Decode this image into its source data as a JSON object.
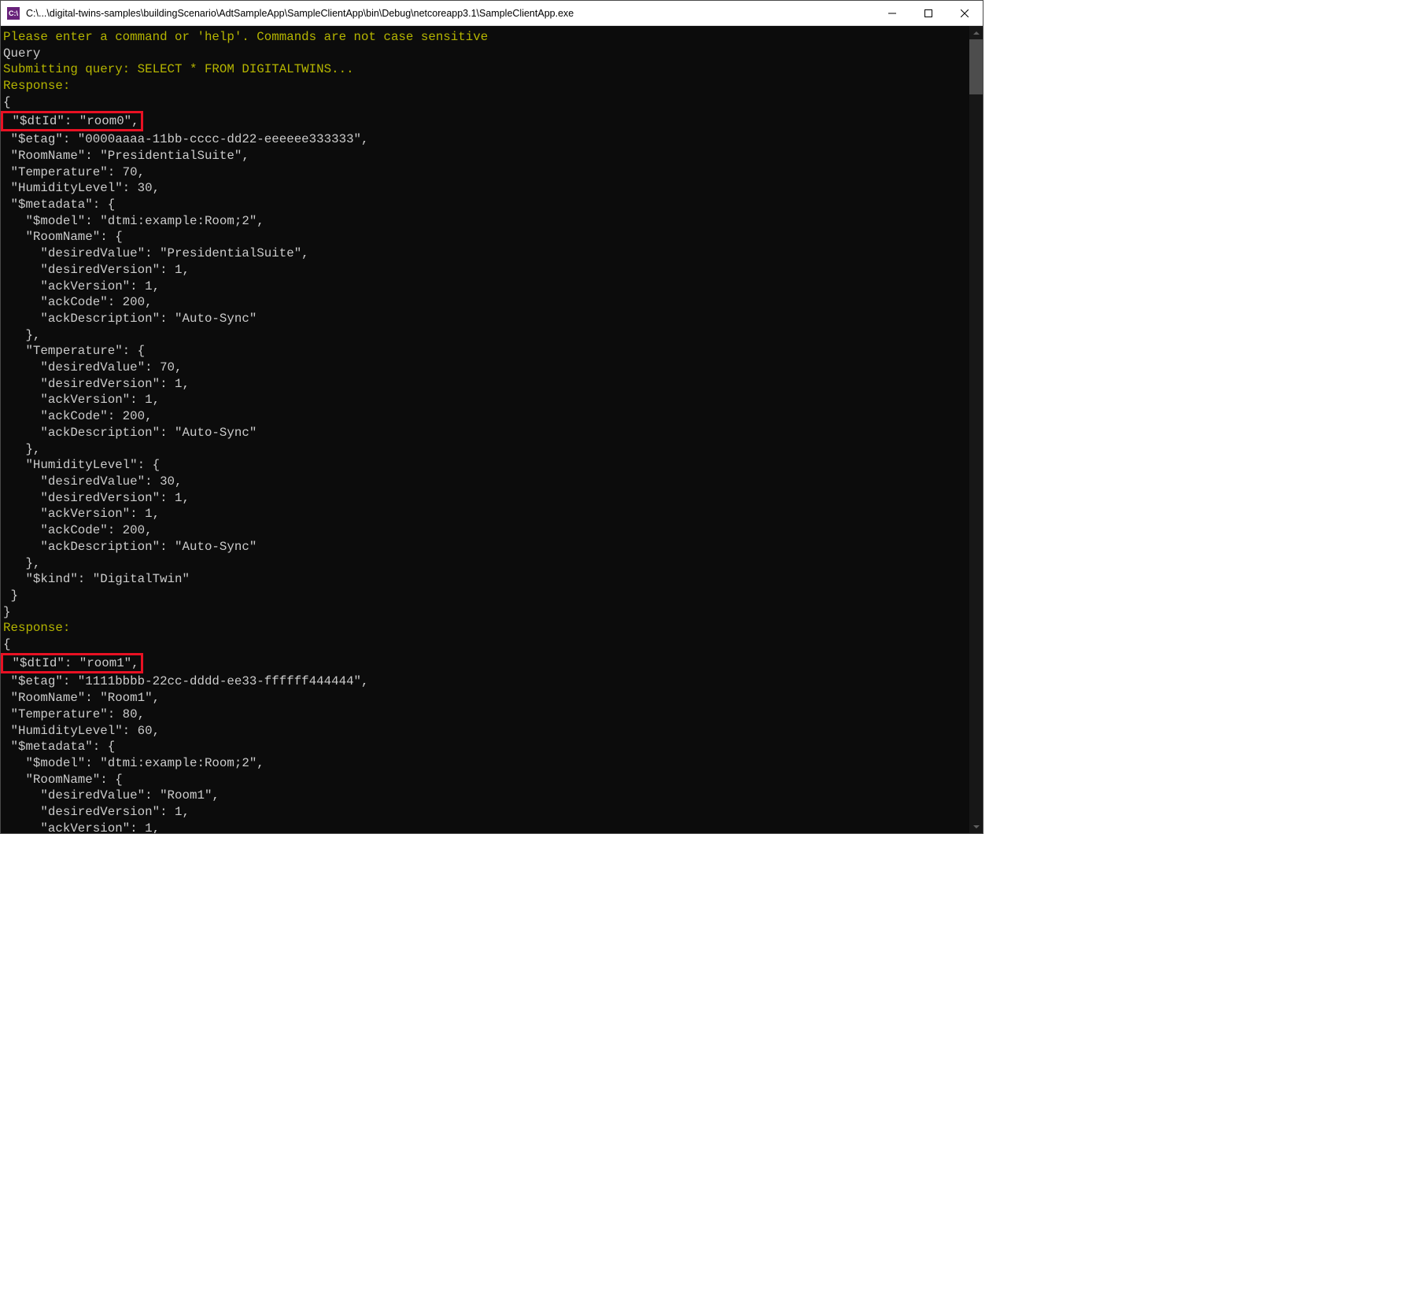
{
  "titlebar": {
    "icon_text": "C:\\",
    "path": "C:\\...\\digital-twins-samples\\buildingScenario\\AdtSampleApp\\SampleClientApp\\bin\\Debug\\netcoreapp3.1\\SampleClientApp.exe"
  },
  "console": {
    "prompt_line": "Please enter a command or 'help'. Commands are not case sensitive",
    "query_cmd": "Query",
    "submit_line": "Submitting query: SELECT * FROM DIGITALTWINS...",
    "response_label": "Response:",
    "body1_open": "{",
    "body1_dtid": " \"$dtId\": \"room0\",",
    "body1_rest": " \"$etag\": \"0000aaaa-11bb-cccc-dd22-eeeeee333333\",\n \"RoomName\": \"PresidentialSuite\",\n \"Temperature\": 70,\n \"HumidityLevel\": 30,\n \"$metadata\": {\n   \"$model\": \"dtmi:example:Room;2\",\n   \"RoomName\": {\n     \"desiredValue\": \"PresidentialSuite\",\n     \"desiredVersion\": 1,\n     \"ackVersion\": 1,\n     \"ackCode\": 200,\n     \"ackDescription\": \"Auto-Sync\"\n   },\n   \"Temperature\": {\n     \"desiredValue\": 70,\n     \"desiredVersion\": 1,\n     \"ackVersion\": 1,\n     \"ackCode\": 200,\n     \"ackDescription\": \"Auto-Sync\"\n   },\n   \"HumidityLevel\": {\n     \"desiredValue\": 30,\n     \"desiredVersion\": 1,\n     \"ackVersion\": 1,\n     \"ackCode\": 200,\n     \"ackDescription\": \"Auto-Sync\"\n   },\n   \"$kind\": \"DigitalTwin\"\n }\n}",
    "body2_open": "{",
    "body2_dtid": " \"$dtId\": \"room1\",",
    "body2_rest": " \"$etag\": \"1111bbbb-22cc-dddd-ee33-ffffff444444\",\n \"RoomName\": \"Room1\",\n \"Temperature\": 80,\n \"HumidityLevel\": 60,\n \"$metadata\": {\n   \"$model\": \"dtmi:example:Room;2\",\n   \"RoomName\": {\n     \"desiredValue\": \"Room1\",\n     \"desiredVersion\": 1,\n     \"ackVersion\": 1,"
  }
}
